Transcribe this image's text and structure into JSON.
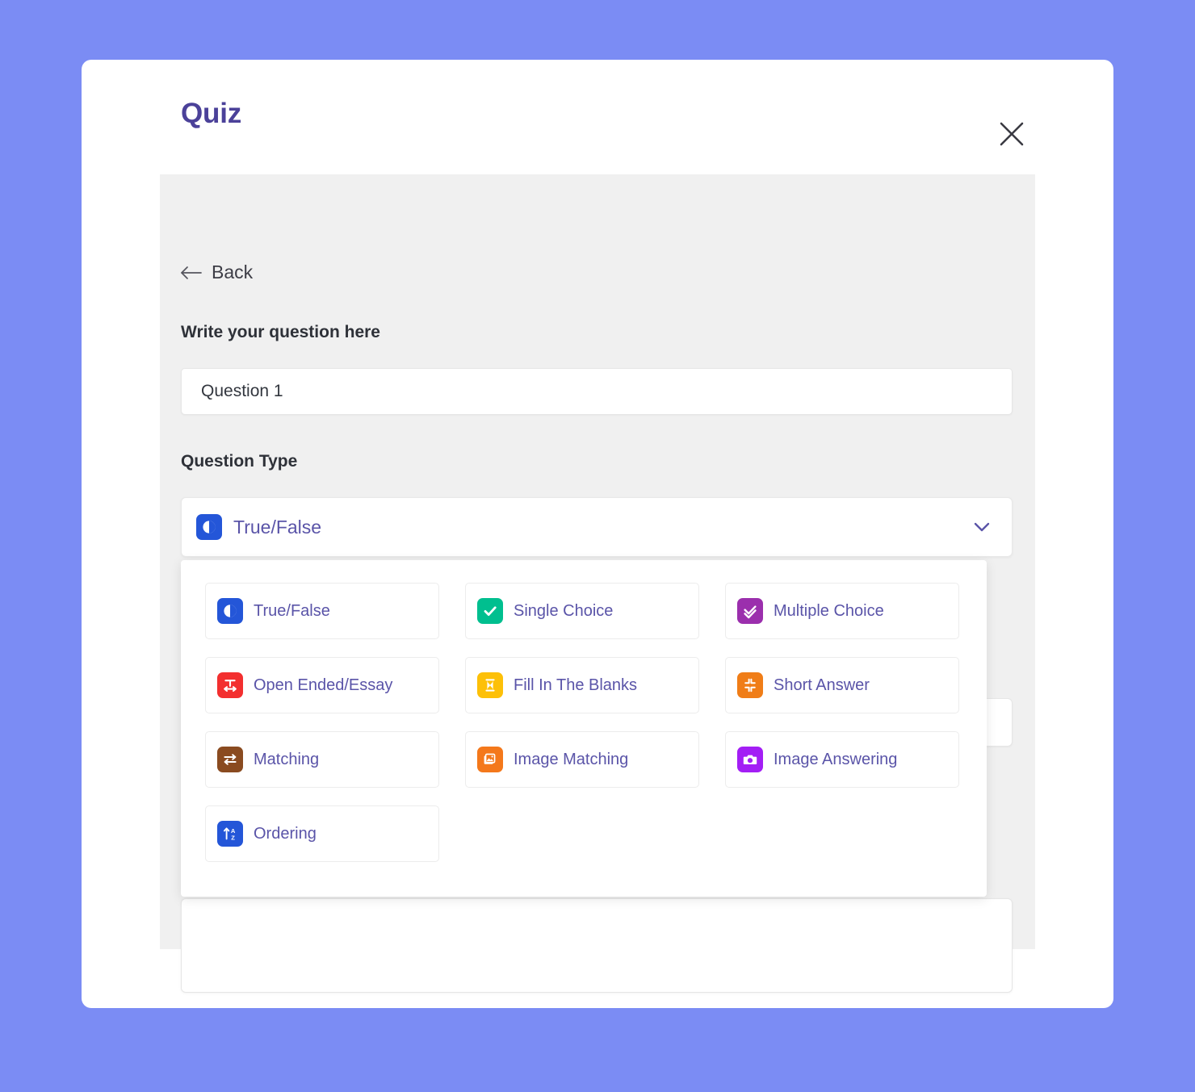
{
  "modal": {
    "title": "Quiz",
    "close_icon": "close-icon"
  },
  "panel": {
    "back": {
      "label": "Back",
      "icon": "arrow-left-icon"
    },
    "question_field": {
      "label": "Write your question here",
      "value": "Question 1",
      "placeholder": "Write your question here"
    },
    "question_type": {
      "label": "Question Type",
      "selected": {
        "label": "True/False",
        "icon": "contrast-icon",
        "color": "#2456d8"
      },
      "chevron_icon": "chevron-down-icon",
      "chevron_color": "#5a54a8"
    }
  },
  "dropdown": {
    "options": [
      {
        "label": "True/False",
        "icon": "contrast-icon",
        "color": "#2456d8"
      },
      {
        "label": "Single Choice",
        "icon": "check-icon",
        "color": "#00bf8f"
      },
      {
        "label": "Multiple Choice",
        "icon": "double-check-icon",
        "color": "#9b2fad"
      },
      {
        "label": "Open Ended/Essay",
        "icon": "text-width-icon",
        "color": "#f32f2f"
      },
      {
        "label": "Fill In The Blanks",
        "icon": "hourglass-icon",
        "color": "#fdc008"
      },
      {
        "label": "Short Answer",
        "icon": "compress-arrows-icon",
        "color": "#f07d17"
      },
      {
        "label": "Matching",
        "icon": "exchange-arrows-icon",
        "color": "#8a4b20"
      },
      {
        "label": "Image Matching",
        "icon": "images-icon",
        "color": "#f4781b"
      },
      {
        "label": "Image Answering",
        "icon": "camera-icon",
        "color": "#a31ef5"
      },
      {
        "label": "Ordering",
        "icon": "sort-alpha-up-icon",
        "color": "#2456d8"
      }
    ]
  },
  "theme": {
    "page_background": "#7b8cf4",
    "modal_background": "#ffffff",
    "panel_background": "#f0f0f0",
    "title_color": "#4b4199",
    "option_text_color": "#5a54a8"
  }
}
